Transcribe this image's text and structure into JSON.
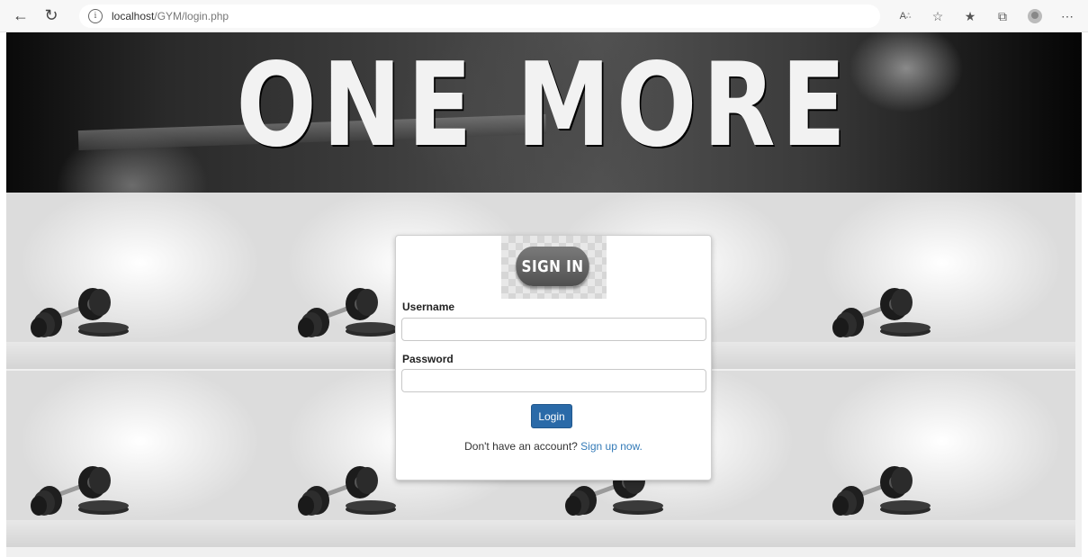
{
  "browser": {
    "url_host": "localhost",
    "url_path": "/GYM/login.php",
    "icons": [
      "back-arrow-icon",
      "refresh-icon",
      "info-icon",
      "read-aloud-icon",
      "add-favorite-icon",
      "favorites-icon",
      "collections-icon",
      "profile-icon",
      "more-icon"
    ]
  },
  "banner": {
    "title": "ONE MORE"
  },
  "login": {
    "heading": "SIGN IN",
    "username_label": "Username",
    "username_value": "",
    "password_label": "Password",
    "password_value": "",
    "submit_label": "Login",
    "signup_prompt": "Don't have an account?",
    "signup_link": "Sign up now."
  },
  "colors": {
    "button": "#2a6aa8",
    "link": "#337ab7"
  }
}
